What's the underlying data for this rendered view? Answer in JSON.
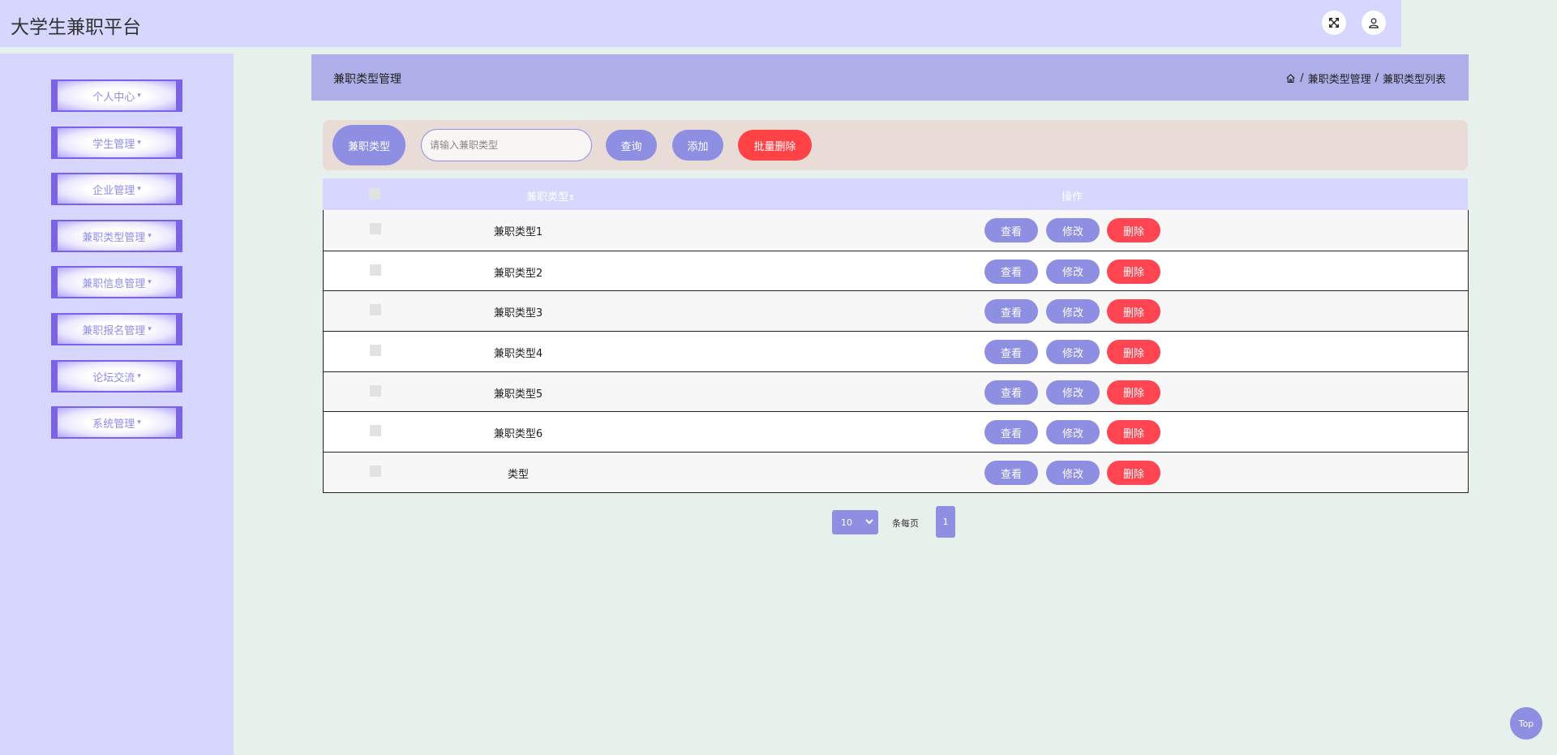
{
  "header": {
    "title": "大学生兼职平台",
    "fullscreen_icon": "fullscreen-icon",
    "user_icon": "user-icon"
  },
  "sidebar": {
    "items": [
      {
        "label": "个人中心"
      },
      {
        "label": "学生管理"
      },
      {
        "label": "企业管理"
      },
      {
        "label": "兼职类型管理"
      },
      {
        "label": "兼职信息管理"
      },
      {
        "label": "兼职报名管理"
      },
      {
        "label": "论坛交流"
      },
      {
        "label": "系统管理"
      }
    ]
  },
  "content_header": {
    "title": "兼职类型管理",
    "breadcrumb": [
      "兼职类型管理",
      "兼职类型列表"
    ],
    "home_icon": "home-icon"
  },
  "search": {
    "label": "兼职类型",
    "placeholder": "请输入兼职类型",
    "value": "",
    "query_button": "查询",
    "add_button": "添加",
    "batch_delete_button": "批量删除"
  },
  "table": {
    "columns": {
      "name": "兼职类型",
      "sort_icon": "sort-icon",
      "operations": "操作"
    },
    "rows": [
      {
        "name": "兼职类型1",
        "view": "查看",
        "edit": "修改",
        "delete": "删除"
      },
      {
        "name": "兼职类型2",
        "view": "查看",
        "edit": "修改",
        "delete": "删除"
      },
      {
        "name": "兼职类型3",
        "view": "查看",
        "edit": "修改",
        "delete": "删除"
      },
      {
        "name": "兼职类型4",
        "view": "查看",
        "edit": "修改",
        "delete": "删除"
      },
      {
        "name": "兼职类型5",
        "view": "查看",
        "edit": "修改",
        "delete": "删除"
      },
      {
        "name": "兼职类型6",
        "view": "查看",
        "edit": "修改",
        "delete": "删除"
      },
      {
        "name": "类型",
        "view": "查看",
        "edit": "修改",
        "delete": "删除"
      }
    ]
  },
  "pagination": {
    "page_size": "10",
    "per_page_label": "条每页",
    "current_page": "1"
  },
  "back_to_top": "Top",
  "colors": {
    "accent": "#8e8ee3",
    "danger": "#ff4246",
    "sidebar_bg": "#d6d6ff",
    "content_bg": "#e7f1ec"
  }
}
